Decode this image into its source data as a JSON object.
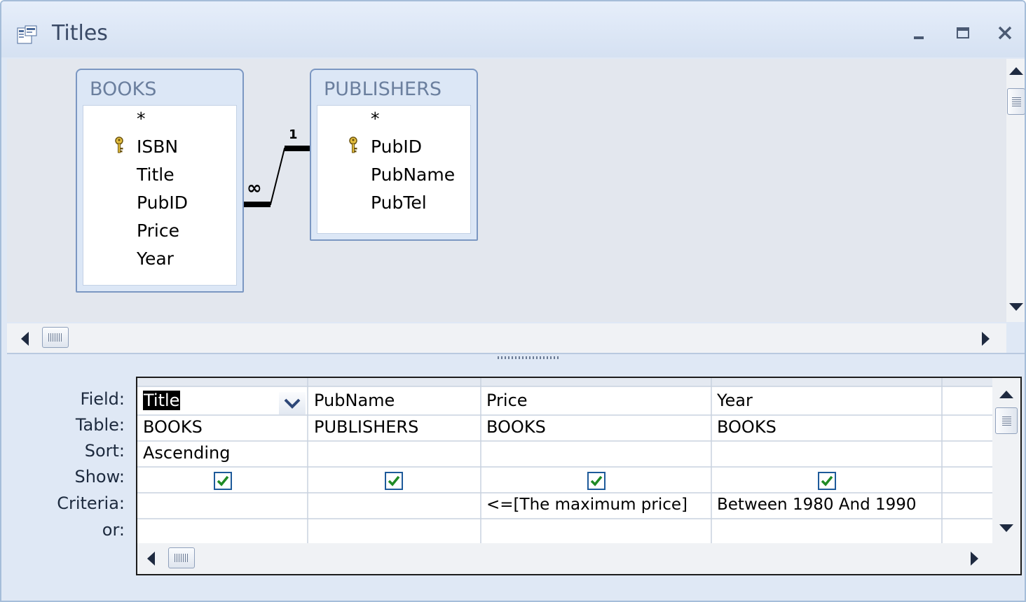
{
  "window": {
    "title": "Titles"
  },
  "relationship": {
    "one_label": "1",
    "many_label": "∞"
  },
  "tables": [
    {
      "name": "BOOKS",
      "fields": [
        "*",
        "ISBN",
        "Title",
        "PubID",
        "Price",
        "Year"
      ],
      "key_field": "ISBN"
    },
    {
      "name": "PUBLISHERS",
      "fields": [
        "*",
        "PubID",
        "PubName",
        "PubTel"
      ],
      "key_field": "PubID"
    }
  ],
  "grid": {
    "row_labels": [
      "Field:",
      "Table:",
      "Sort:",
      "Show:",
      "Criteria:",
      "or:"
    ],
    "columns": [
      {
        "field": "Title",
        "table": "BOOKS",
        "sort": "Ascending",
        "show": true,
        "criteria": "",
        "or": ""
      },
      {
        "field": "PubName",
        "table": "PUBLISHERS",
        "sort": "",
        "show": true,
        "criteria": "",
        "or": ""
      },
      {
        "field": "Price",
        "table": "BOOKS",
        "sort": "",
        "show": true,
        "criteria": "<=[The maximum price]",
        "or": ""
      },
      {
        "field": "Year",
        "table": "BOOKS",
        "sort": "",
        "show": true,
        "criteria": "Between 1980 And 1990",
        "or": ""
      }
    ]
  },
  "icons": {
    "window": "query-design-icon",
    "key": "primary-key-icon",
    "check": "checkmark-icon"
  }
}
